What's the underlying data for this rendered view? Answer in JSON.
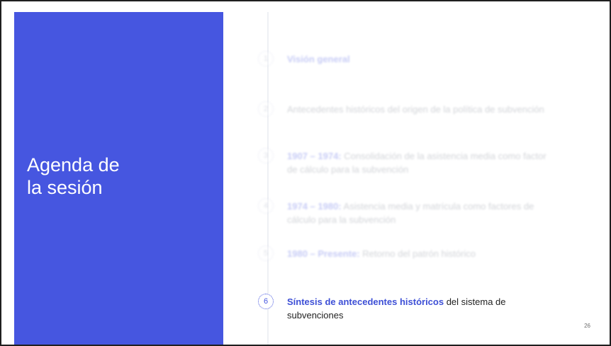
{
  "title": {
    "line1": "Agenda de",
    "line2": "la sesión"
  },
  "agenda": [
    {
      "num": "1",
      "highlight": "Visión general",
      "rest": ""
    },
    {
      "num": "2",
      "highlight": "",
      "rest": "Antecedentes históricos del origen de la política de subvención"
    },
    {
      "num": "3",
      "highlight": "1907 – 1974:",
      "rest": " Consolidación de la asistencia media como factor de cálculo para la subvención"
    },
    {
      "num": "4",
      "highlight": "1974 – 1980:",
      "rest": " Asistencia media y matrícula como factores de cálculo para la subvención"
    },
    {
      "num": "5",
      "highlight": "1980 – Presente:",
      "rest": " Retorno del patrón histórico"
    },
    {
      "num": "6",
      "highlight": "Síntesis de antecedentes históricos",
      "rest": " del sistema de subvenciones"
    }
  ],
  "page_number": "26",
  "colors": {
    "accent": "#4656e0"
  }
}
